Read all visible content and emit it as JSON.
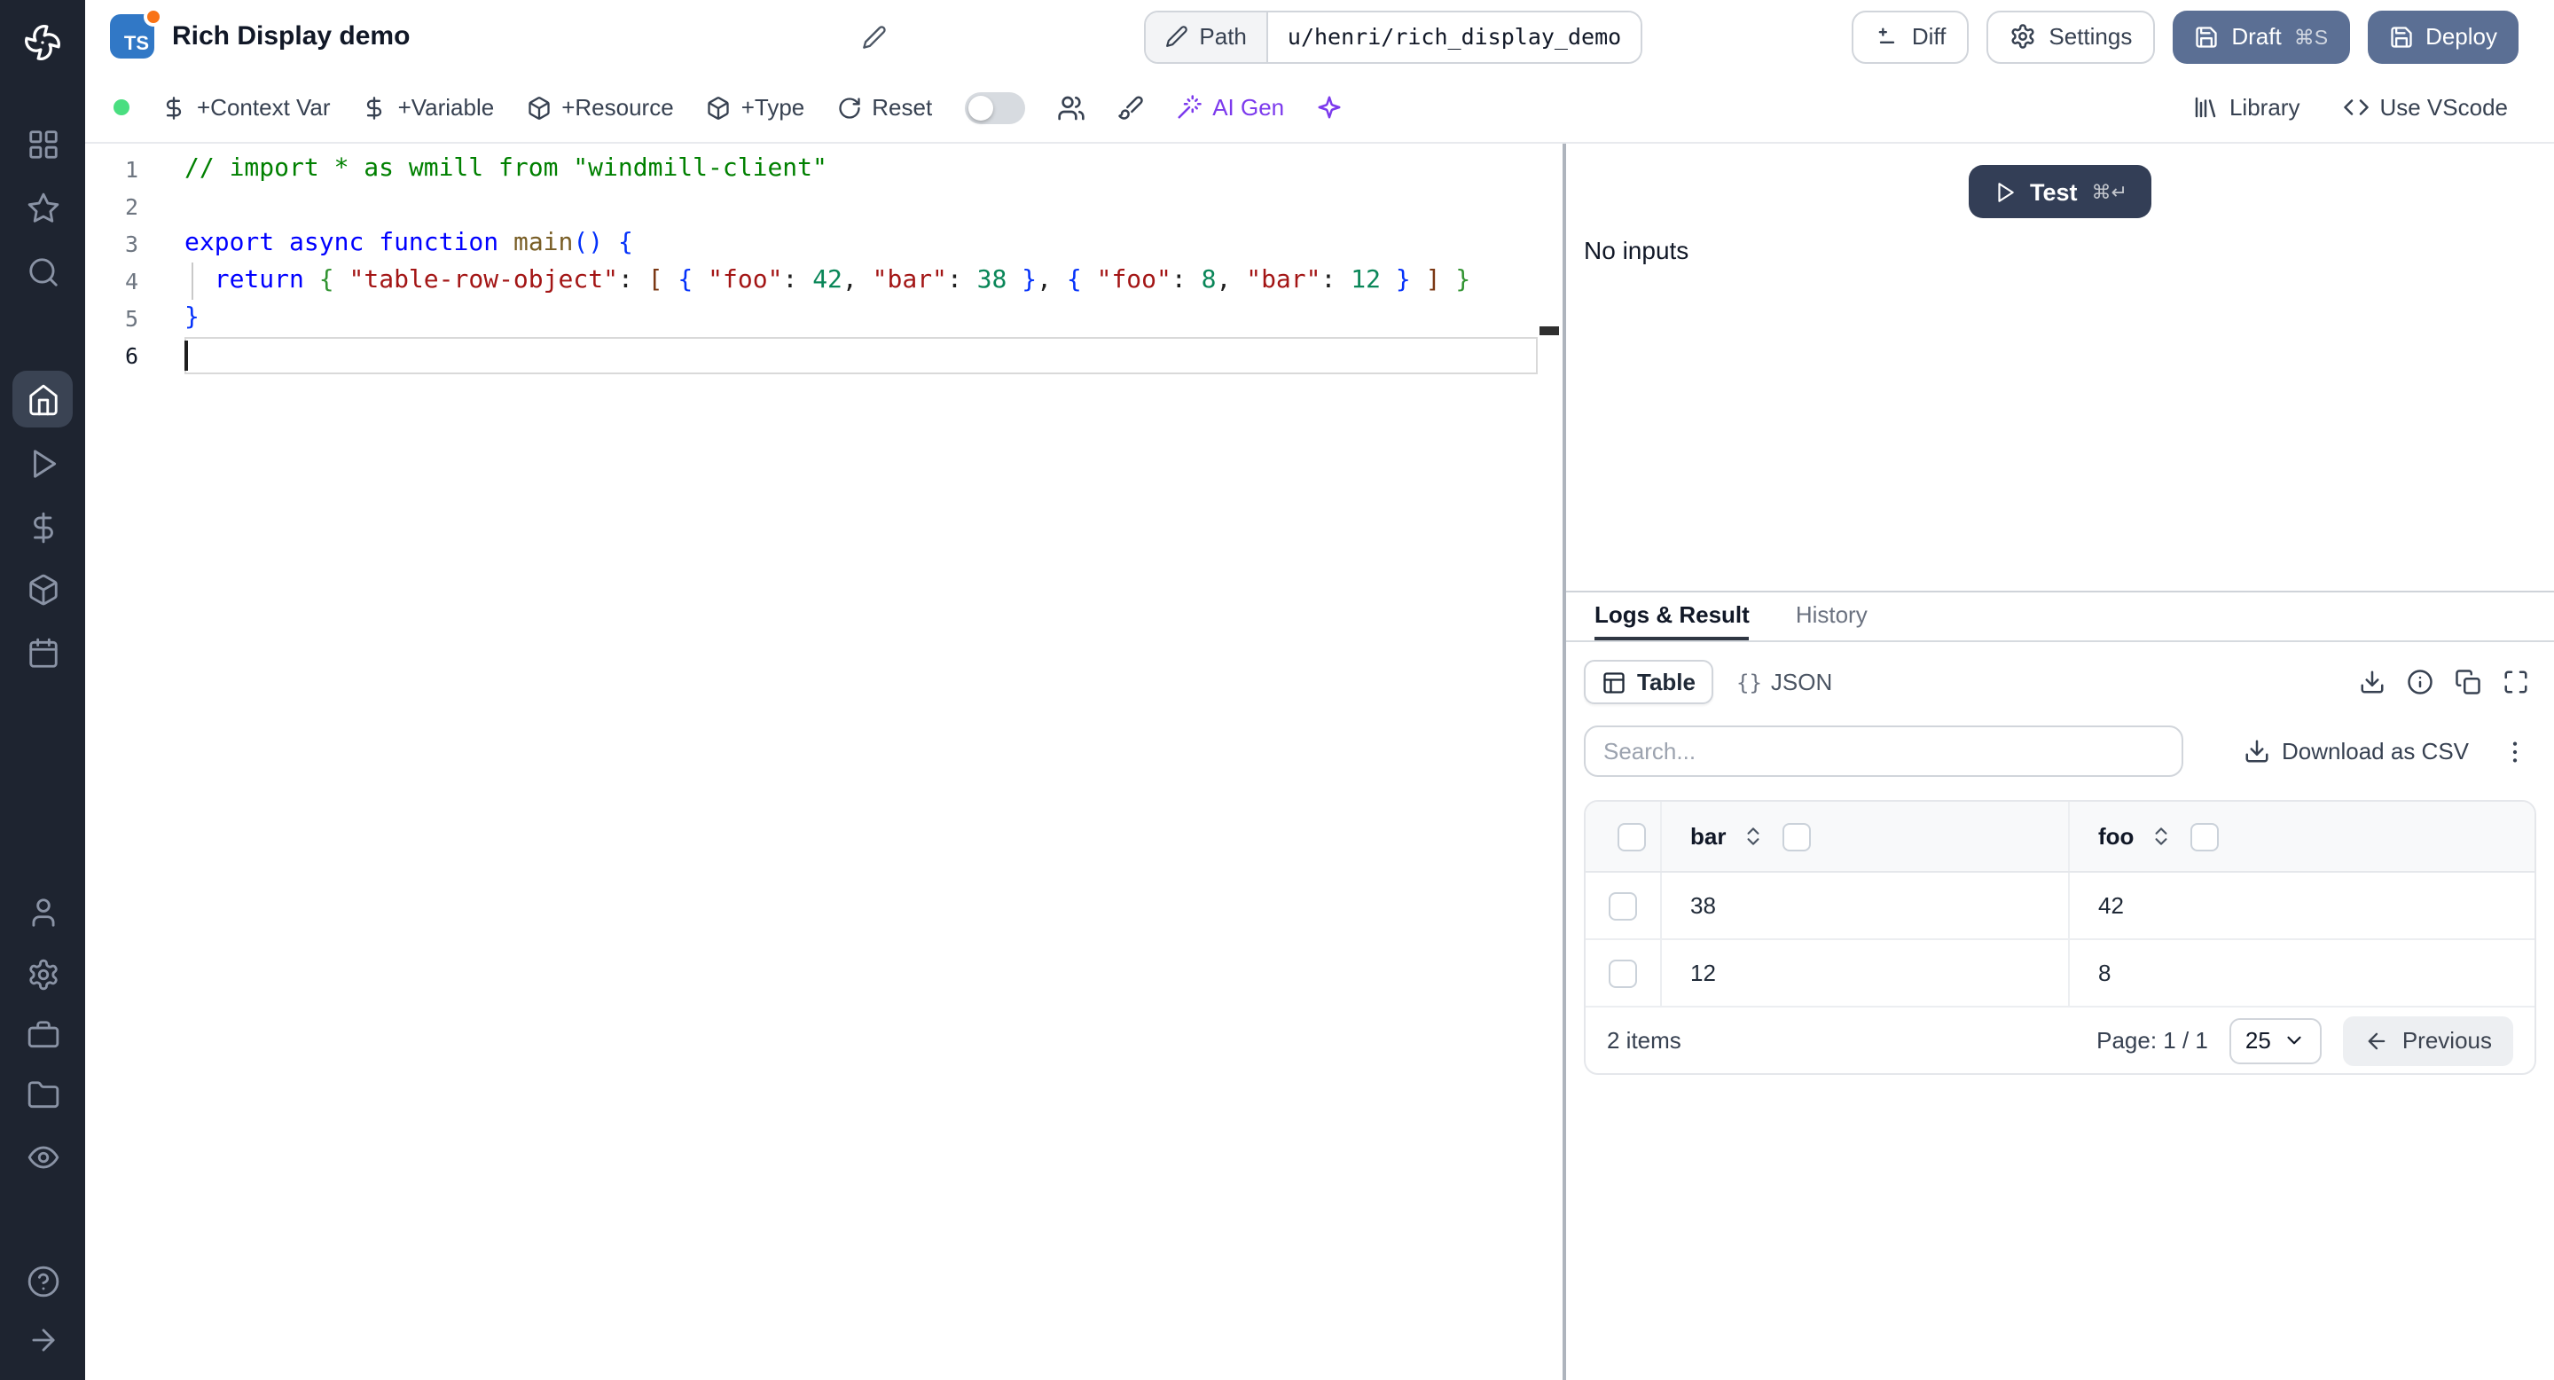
{
  "colors": {
    "sidebar_bg": "#1e2430",
    "sidebar_active_bg": "#3a4353",
    "primary_btn": "#5b6f94",
    "test_btn": "#333e56",
    "ai_purple": "#7c3aed",
    "green_dot": "#4ade80",
    "ts_blue": "#3178c6"
  },
  "sidebar": {
    "icons": [
      "windmill-logo",
      "grid-icon",
      "star-icon",
      "search-icon",
      "home-icon",
      "play-icon",
      "dollar-icon",
      "box-icon",
      "calendar-icon",
      "user-icon",
      "gear-icon",
      "briefcase-icon",
      "folder-icon",
      "eye-icon",
      "help-circle-icon",
      "arrow-right-icon"
    ],
    "active_item": "home"
  },
  "header": {
    "lang_badge": "TS",
    "title": "Rich Display demo",
    "path_label": "Path",
    "path_value": "u/henri/rich_display_demo",
    "diff": "Diff",
    "settings": "Settings",
    "draft": "Draft",
    "draft_shortcut": "⌘S",
    "deploy": "Deploy"
  },
  "toolbar": {
    "context_var": "+Context Var",
    "variable": "+Variable",
    "resource": "+Resource",
    "type": "+Type",
    "reset": "Reset",
    "ai_gen": "AI Gen",
    "library": "Library",
    "use_vscode": "Use VScode"
  },
  "editor": {
    "lines": [
      {
        "num": "1",
        "tokens": [
          [
            "// import * as wmill from \"windmill-client\"",
            "cm"
          ]
        ]
      },
      {
        "num": "2",
        "tokens": []
      },
      {
        "num": "3",
        "tokens": [
          [
            "export",
            "kw"
          ],
          [
            " ",
            "pl"
          ],
          [
            "async",
            "kw"
          ],
          [
            " ",
            "pl"
          ],
          [
            "function",
            "kw"
          ],
          [
            " ",
            "pl"
          ],
          [
            "main",
            "fn"
          ],
          [
            "(",
            "br1"
          ],
          [
            ")",
            "br1"
          ],
          [
            " ",
            "pl"
          ],
          [
            "{",
            "br1"
          ]
        ]
      },
      {
        "num": "4",
        "tokens": [
          [
            "  ",
            "pl"
          ],
          [
            "return",
            "kw"
          ],
          [
            " ",
            "pl"
          ],
          [
            "{",
            "br2"
          ],
          [
            " ",
            "pl"
          ],
          [
            "\"table-row-object\"",
            "str"
          ],
          [
            ": ",
            "pl"
          ],
          [
            "[",
            "br3"
          ],
          [
            " ",
            "pl"
          ],
          [
            "{",
            "br4"
          ],
          [
            " ",
            "pl"
          ],
          [
            "\"foo\"",
            "str"
          ],
          [
            ": ",
            "pl"
          ],
          [
            "42",
            "num"
          ],
          [
            ", ",
            "pl"
          ],
          [
            "\"bar\"",
            "str"
          ],
          [
            ": ",
            "pl"
          ],
          [
            "38",
            "num"
          ],
          [
            " ",
            "pl"
          ],
          [
            "}",
            "br4"
          ],
          [
            ", ",
            "pl"
          ],
          [
            "{",
            "br4"
          ],
          [
            " ",
            "pl"
          ],
          [
            "\"foo\"",
            "str"
          ],
          [
            ": ",
            "pl"
          ],
          [
            "8",
            "num"
          ],
          [
            ", ",
            "pl"
          ],
          [
            "\"bar\"",
            "str"
          ],
          [
            ": ",
            "pl"
          ],
          [
            "12",
            "num"
          ],
          [
            " ",
            "pl"
          ],
          [
            "}",
            "br4"
          ],
          [
            " ",
            "pl"
          ],
          [
            "]",
            "br3"
          ],
          [
            " ",
            "pl"
          ],
          [
            "}",
            "br2"
          ]
        ]
      },
      {
        "num": "5",
        "tokens": [
          [
            "}",
            "br1"
          ]
        ]
      },
      {
        "num": "6",
        "tokens": [],
        "active": true
      }
    ]
  },
  "runner": {
    "test": "Test",
    "shortcut": "⌘↵",
    "no_inputs": "No inputs"
  },
  "results": {
    "tabs": {
      "logs": "Logs & Result",
      "history": "History"
    },
    "toggle": {
      "table": "Table",
      "json_glyph": "{}",
      "json": "JSON"
    },
    "action_icons": [
      "download-icon",
      "info-icon",
      "clipboard-copy-icon",
      "maximize-icon"
    ],
    "search_placeholder": "Search...",
    "download_csv": "Download as CSV",
    "table": {
      "columns": [
        "bar",
        "foo"
      ],
      "rows": [
        [
          "38",
          "42"
        ],
        [
          "12",
          "8"
        ]
      ],
      "items_label": "2 items",
      "page_label": "Page: 1 / 1",
      "per_page": "25",
      "previous": "Previous"
    }
  }
}
